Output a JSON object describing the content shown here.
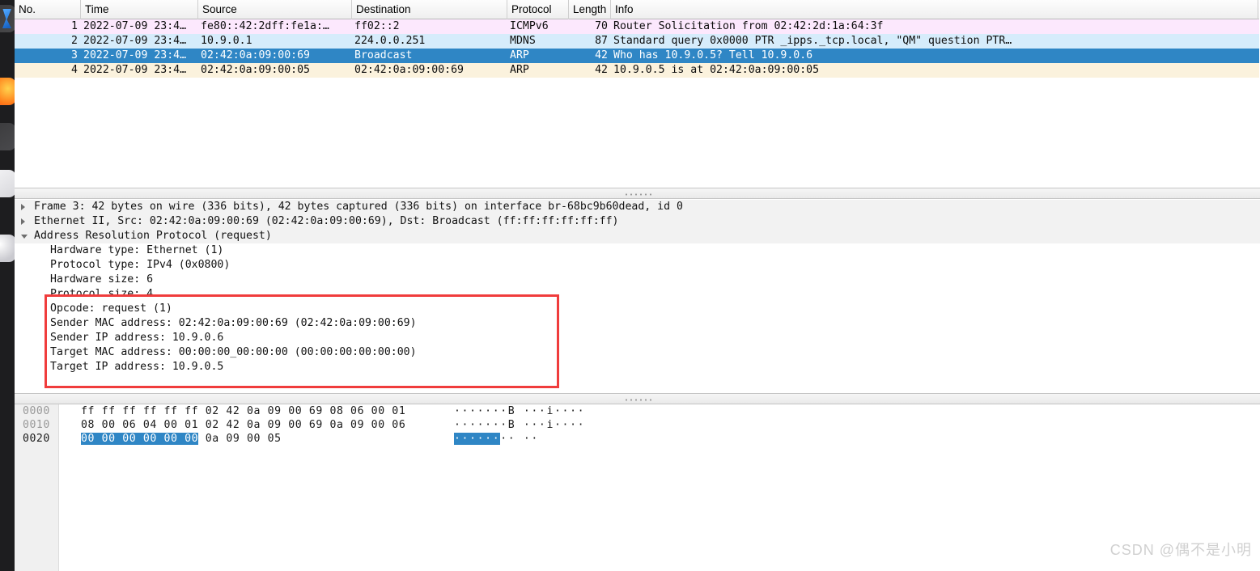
{
  "dock": {
    "icons": [
      {
        "name": "code-editor-icon"
      },
      {
        "name": "firefox-icon"
      },
      {
        "name": "terminal-icon"
      },
      {
        "name": "files-icon"
      },
      {
        "name": "settings-icon"
      }
    ]
  },
  "packet_list": {
    "columns": [
      "No.",
      "Time",
      "Source",
      "Destination",
      "Protocol",
      "Length",
      "Info"
    ],
    "rows": [
      {
        "no": "1",
        "time": "2022-07-09 23:4…",
        "source": "fe80::42:2dff:fe1a:…",
        "destination": "ff02::2",
        "protocol": "ICMPv6",
        "length": "70",
        "info": "Router Solicitation from 02:42:2d:1a:64:3f",
        "style": "r-pink"
      },
      {
        "no": "2",
        "time": "2022-07-09 23:4…",
        "source": "10.9.0.1",
        "destination": "224.0.0.251",
        "protocol": "MDNS",
        "length": "87",
        "info": "Standard query 0x0000 PTR _ipps._tcp.local, \"QM\" question PTR…",
        "style": "r-blue"
      },
      {
        "no": "3",
        "time": "2022-07-09 23:4…",
        "source": "02:42:0a:09:00:69",
        "destination": "Broadcast",
        "protocol": "ARP",
        "length": "42",
        "info": "Who has 10.9.0.5? Tell 10.9.0.6",
        "style": "r-sel"
      },
      {
        "no": "4",
        "time": "2022-07-09 23:4…",
        "source": "02:42:0a:09:00:05",
        "destination": "02:42:0a:09:00:69",
        "protocol": "ARP",
        "length": "42",
        "info": "10.9.0.5 is at 02:42:0a:09:00:05",
        "style": "r-cream"
      }
    ]
  },
  "detail_tree": {
    "nodes": [
      {
        "label": "Frame 3: 42 bytes on wire (336 bits), 42 bytes captured (336 bits) on interface br-68bc9b60dead, id 0",
        "level": "top",
        "arrow": "collapsed"
      },
      {
        "label": "Ethernet II, Src: 02:42:0a:09:00:69 (02:42:0a:09:00:69), Dst: Broadcast (ff:ff:ff:ff:ff:ff)",
        "level": "top",
        "arrow": "collapsed"
      },
      {
        "label": "Address Resolution Protocol (request)",
        "level": "top",
        "arrow": "expanded"
      },
      {
        "label": "Hardware type: Ethernet (1)",
        "level": "child",
        "arrow": "none"
      },
      {
        "label": "Protocol type: IPv4 (0x0800)",
        "level": "child",
        "arrow": "none"
      },
      {
        "label": "Hardware size: 6",
        "level": "child",
        "arrow": "none"
      },
      {
        "label": "Protocol size: 4",
        "level": "child",
        "arrow": "none"
      },
      {
        "label": "Opcode: request (1)",
        "level": "child",
        "arrow": "none"
      },
      {
        "label": "Sender MAC address: 02:42:0a:09:00:69 (02:42:0a:09:00:69)",
        "level": "child",
        "arrow": "none"
      },
      {
        "label": "Sender IP address: 10.9.0.6",
        "level": "child",
        "arrow": "none"
      },
      {
        "label": "Target MAC address: 00:00:00_00:00:00 (00:00:00:00:00:00)",
        "level": "child",
        "arrow": "none"
      },
      {
        "label": "Target IP address: 10.9.0.5",
        "level": "child",
        "arrow": "none"
      }
    ]
  },
  "annotation": {
    "shape": "rectangle",
    "color": "#f03c3c"
  },
  "hex_dump": {
    "rows": [
      {
        "offset": "0000",
        "offset_highlighted": false,
        "bytes_plain_1": "ff ff ff ff ff ff 02 42",
        "bytes_plain_2": "0a 09 00 69 08 06 00 01",
        "bytes_selected": "",
        "ascii_selected": "",
        "ascii_plain": "·······B ···i····"
      },
      {
        "offset": "0010",
        "offset_highlighted": false,
        "bytes_plain_1": "08 00 06 04 00 01 02 42",
        "bytes_plain_2": "0a 09 00 69 0a 09 00 06",
        "bytes_selected": "",
        "ascii_selected": "",
        "ascii_plain": "·······B ···i····"
      },
      {
        "offset": "0020",
        "offset_highlighted": true,
        "bytes_plain_1": "",
        "bytes_plain_2": "",
        "bytes_selected": "00 00 00 00 00 00",
        "bytes_trailing": " 0a 09  00 05",
        "ascii_selected": "······",
        "ascii_plain": "·· ··"
      }
    ]
  },
  "watermark": {
    "text": "CSDN @偶不是小明"
  },
  "colors": {
    "selection_blue": "#2f86c5",
    "row_pink": "#fce8fd",
    "row_blue": "#d6ecfb",
    "row_cream": "#fbf2dd",
    "annotation_red": "#f03c3c"
  }
}
